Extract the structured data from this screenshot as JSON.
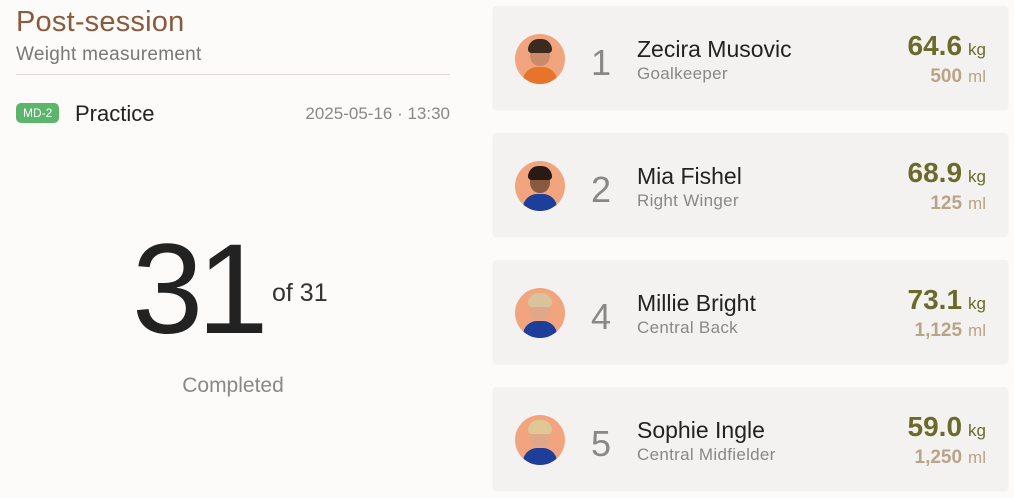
{
  "header": {
    "title": "Post-session",
    "subtitle": "Weight measurement"
  },
  "session": {
    "badge": "MD-2",
    "type": "Practice",
    "datetime": "2025-05-16 · 13:30"
  },
  "progress": {
    "completed": "31",
    "total_text": "of 31",
    "label": "Completed"
  },
  "colors": {
    "title": "#8a5a3c",
    "badge": "#5bb56a",
    "weight": "#6b6a2b",
    "volume": "#b8a486",
    "avatar_bg": "#f1a47d"
  },
  "players": [
    {
      "rank": "1",
      "name": "Zecira Musovic",
      "position": "Goalkeeper",
      "weight": "64.6",
      "weight_unit": "kg",
      "volume": "500",
      "volume_unit": "ml",
      "kit_color": "#e8742c",
      "hair_color": "#3a2a20"
    },
    {
      "rank": "2",
      "name": "Mia Fishel",
      "position": "Right Winger",
      "weight": "68.9",
      "weight_unit": "kg",
      "volume": "125",
      "volume_unit": "ml",
      "kit_color": "#1d3f9a",
      "hair_color": "#2a1a14"
    },
    {
      "rank": "4",
      "name": "Millie Bright",
      "position": "Central Back",
      "weight": "73.1",
      "weight_unit": "kg",
      "volume": "1,125",
      "volume_unit": "ml",
      "kit_color": "#1d3f9a",
      "hair_color": "#d8c39a"
    },
    {
      "rank": "5",
      "name": "Sophie Ingle",
      "position": "Central Midfielder",
      "weight": "59.0",
      "weight_unit": "kg",
      "volume": "1,250",
      "volume_unit": "ml",
      "kit_color": "#1d3f9a",
      "hair_color": "#e0c895"
    }
  ]
}
